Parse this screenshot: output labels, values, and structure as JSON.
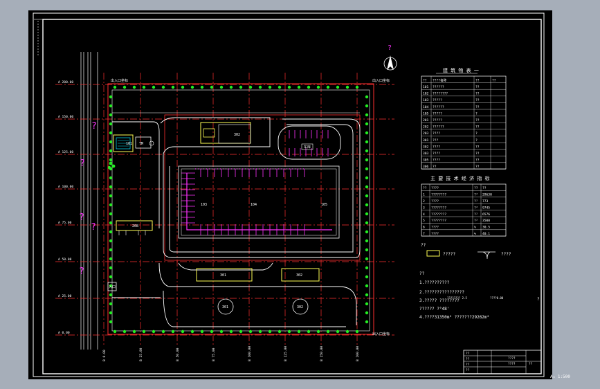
{
  "north_mark": "?",
  "grid_y": [
    "A 200.00",
    "A 150.00",
    "A 125.00",
    "A 100.00",
    "A 75.00",
    "A 50.00",
    "A 25.00",
    "A 0.00"
  ],
  "grid_x": [
    "B 0.00",
    "B 25.00",
    "B 50.00",
    "B 75.00",
    "B 100.00",
    "B 125.00",
    "B 150.00",
    "B 200.00"
  ],
  "corner_tl": "出入口坐标",
  "corner_tr": "出入口坐标",
  "corner_br": "出入口坐标",
  "left_marks": [
    "?",
    "?",
    "?",
    "?",
    "?"
  ],
  "buildings": {
    "b_top": "302",
    "b_guard": "101",
    "b_guard2": "TM",
    "b_car": "车库",
    "b_left_mid": "208",
    "b_yard_l": "103",
    "b_yard_c": "104",
    "b_yard_r": "105",
    "b_bottom_l": "301",
    "b_bottom_r": "302",
    "tank_l": "301",
    "tank_r": "302",
    "gate_small": "入口"
  },
  "table1": {
    "title": "建 筑 物 表 一",
    "headers": [
      "??",
      "????名称",
      "??",
      "??"
    ],
    "rows": [
      [
        "101",
        "??????",
        "??",
        ""
      ],
      [
        "102",
        "????????",
        "??",
        ""
      ],
      [
        "103",
        "?????",
        "??",
        ""
      ],
      [
        "104",
        "??????",
        "??",
        ""
      ],
      [
        "105",
        "?????",
        "?",
        ""
      ],
      [
        "201",
        "?????",
        "??",
        ""
      ],
      [
        "202",
        "??????",
        "??",
        ""
      ],
      [
        "203",
        "????",
        "?",
        ""
      ],
      [
        "301",
        "???",
        "?",
        ""
      ],
      [
        "302",
        "????",
        "??",
        ""
      ],
      [
        "303",
        "????",
        "??",
        ""
      ],
      [
        "305",
        "????",
        "??",
        ""
      ],
      [
        "306",
        "??",
        "??",
        ""
      ]
    ]
  },
  "table2": {
    "title": "主 要 技 术 经 济 指 标",
    "headers": [
      "??",
      "????",
      "??",
      "??"
    ],
    "rows": [
      [
        "1",
        "????????",
        "?²",
        "29630"
      ],
      [
        "2",
        "????",
        "?²",
        "773"
      ],
      [
        "3",
        "????????",
        "?²",
        "9745"
      ],
      [
        "4",
        "????????",
        "?²",
        "6576"
      ],
      [
        "5",
        "????????",
        "?²",
        "3500"
      ],
      [
        "6",
        "????",
        "%",
        "30.5"
      ],
      [
        "7",
        "????",
        "%",
        "40.1"
      ]
    ]
  },
  "legend": {
    "title": "??",
    "item1": "?????",
    "item2": "????"
  },
  "notes": {
    "title": "??",
    "lines": [
      "1.??????????",
      "2.????????????????",
      "3.????? ????????",
      "  ?????? ?°48'",
      "4.????31350m² ???????29262m²"
    ],
    "ref_a": "???????? 2.5",
    "ref_b": "????0.00",
    "question": "?"
  },
  "title_block": {
    "rows": [
      "??",
      "??",
      "??",
      "??"
    ],
    "project": "????",
    "drawing": "????",
    "num": "??"
  },
  "scale_label": "A₃ 1:500"
}
